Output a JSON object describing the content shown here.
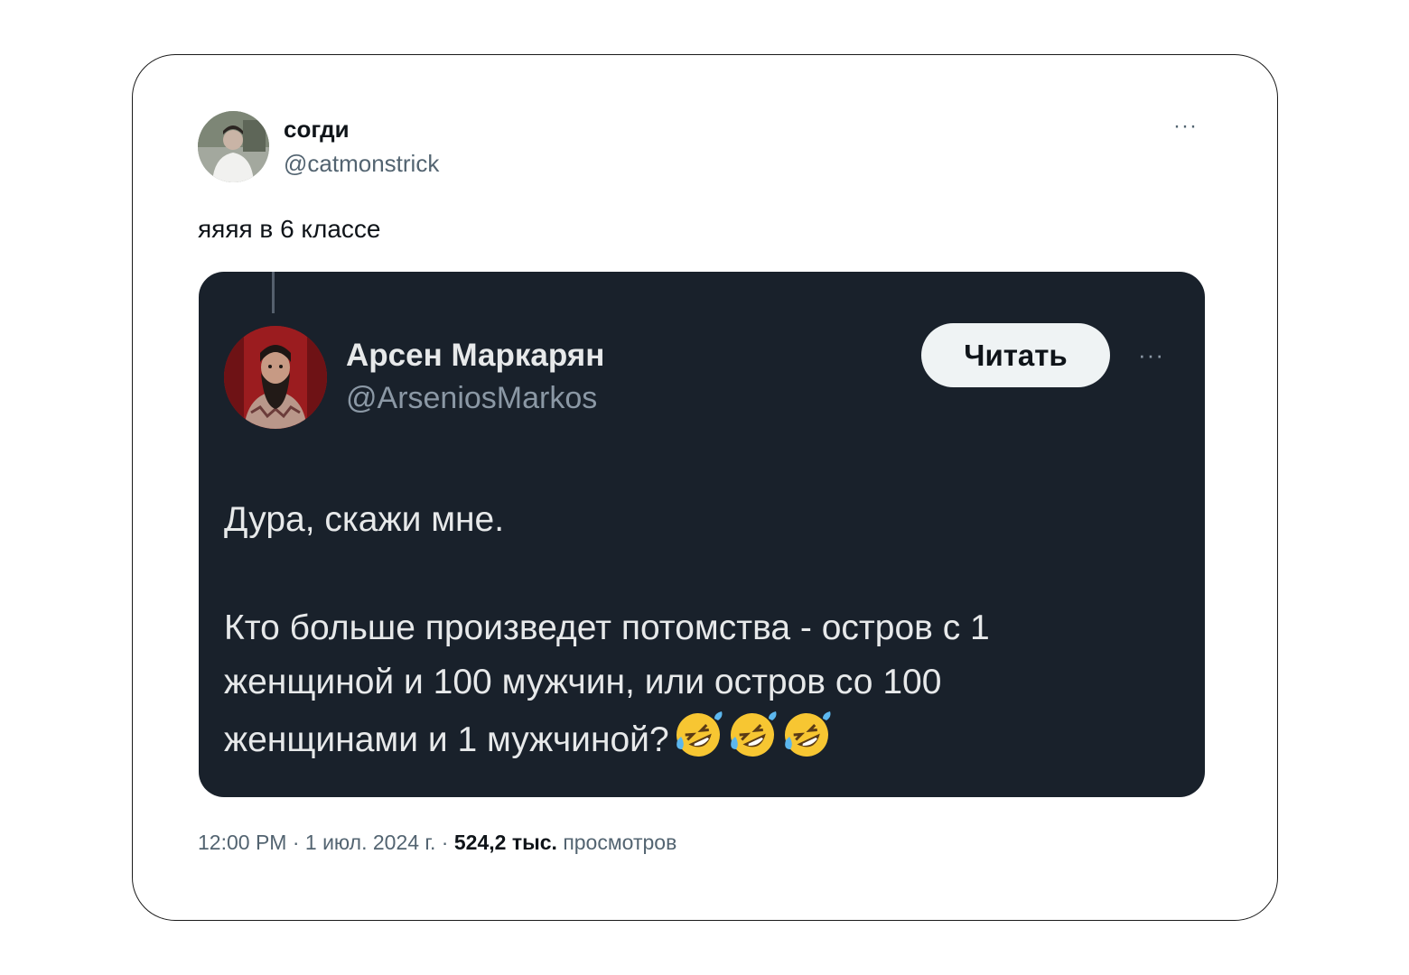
{
  "tweet": {
    "author_name": "согди",
    "author_handle": "@catmonstrick",
    "more_label": "···",
    "text": "яяяя в 6 классе",
    "meta": {
      "time": "12:00 PM",
      "separator": " · ",
      "date": "1 июл. 2024 г.",
      "views_count": "524,2 тыс.",
      "views_label": "просмотров"
    }
  },
  "quote": {
    "author_name": "Арсен Маркарян",
    "author_handle": "@ArseniosMarkos",
    "follow_label": "Читать",
    "more_label": "···",
    "line1": "Дура, скажи мне.",
    "line2": "Кто больше произведет потомства - остров с 1",
    "line3": "женщиной и 100 мужчин, или остров со 100",
    "line4": "женщинами и 1 мужчиной?",
    "emojis": [
      "rolling-on-floor-laughing",
      "rolling-on-floor-laughing",
      "rolling-on-floor-laughing"
    ]
  },
  "colors": {
    "quote_bg": "#19212b",
    "secondary_text": "#536471",
    "button_bg": "#eff3f4"
  }
}
